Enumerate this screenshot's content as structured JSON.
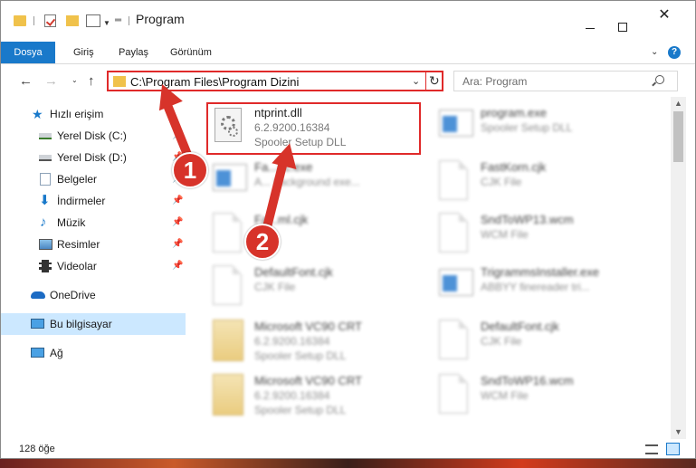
{
  "window": {
    "title": "Program"
  },
  "ribbon": {
    "tabs": [
      {
        "label": "Dosya"
      },
      {
        "label": "Giriş"
      },
      {
        "label": "Paylaş"
      },
      {
        "label": "Görünüm"
      }
    ]
  },
  "address": {
    "path": "C:\\Program Files\\Program Dizini"
  },
  "search": {
    "placeholder": "Ara: Program"
  },
  "sidebar": {
    "items": [
      {
        "label": "Hızlı erişim",
        "icon": "star-icon"
      },
      {
        "label": "Yerel Disk (C:)",
        "icon": "drive-icon"
      },
      {
        "label": "Yerel Disk (D:)",
        "icon": "drive-icon"
      },
      {
        "label": "Belgeler",
        "icon": "documents-icon"
      },
      {
        "label": "İndirmeler",
        "icon": "download-icon"
      },
      {
        "label": "Müzik",
        "icon": "music-icon"
      },
      {
        "label": "Resimler",
        "icon": "pictures-icon"
      },
      {
        "label": "Videolar",
        "icon": "video-icon"
      },
      {
        "label": "OneDrive",
        "icon": "cloud-icon"
      },
      {
        "label": "Bu bilgisayar",
        "icon": "computer-icon"
      },
      {
        "label": "Ağ",
        "icon": "network-icon"
      }
    ]
  },
  "files": [
    {
      "name": "ntprint.dll",
      "line2": "6.2.9200.16384",
      "line3": "Spooler Setup DLL",
      "kind": "dll"
    },
    {
      "name": "program.exe",
      "line2": "Spooler Setup DLL",
      "line3": "",
      "kind": "exe"
    },
    {
      "name": "Fa...ec.exe",
      "line2": "A... background exe...",
      "line3": "",
      "kind": "exe"
    },
    {
      "name": "FastKorn.cjk",
      "line2": "CJK File",
      "line3": "",
      "kind": "doc"
    },
    {
      "name": "Fa...ml.cjk",
      "line2": "",
      "line3": "",
      "kind": "doc"
    },
    {
      "name": "SndToWP13.wcm",
      "line2": "WCM File",
      "line3": "",
      "kind": "doc"
    },
    {
      "name": "DefaultFont.cjk",
      "line2": "CJK File",
      "line3": "",
      "kind": "doc"
    },
    {
      "name": "TrigrammsInstaller.exe",
      "line2": "ABBYY finereader tri...",
      "line3": "",
      "kind": "exe"
    },
    {
      "name": "Microsoft VC90 CRT",
      "line2": "6.2.9200.16384",
      "line3": "Spooler Setup DLL",
      "kind": "setup"
    },
    {
      "name": "DefaultFont.cjk",
      "line2": "CJK File",
      "line3": "",
      "kind": "doc"
    },
    {
      "name": "Microsoft VC90 CRT",
      "line2": "6.2.9200.16384",
      "line3": "Spooler Setup DLL",
      "kind": "setup"
    },
    {
      "name": "SndToWP16.wcm",
      "line2": "WCM File",
      "line3": "",
      "kind": "doc"
    }
  ],
  "status": {
    "count": "128 öğe"
  },
  "annotations": {
    "badge1": "1",
    "badge2": "2"
  },
  "colors": {
    "accent": "#1979ca",
    "highlight": "#e02a2a",
    "annotation": "#d7332a"
  }
}
